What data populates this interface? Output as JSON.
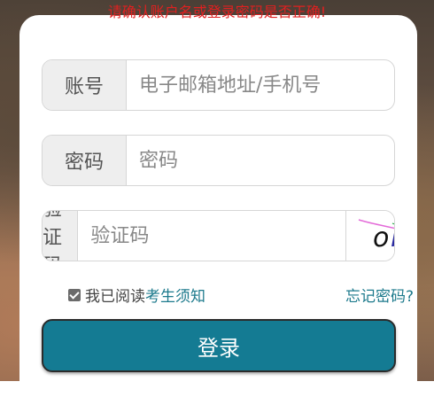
{
  "error_message": "请确认账户名或登录密码是否正确!",
  "account": {
    "label": "账号",
    "placeholder": "电子邮箱地址/手机号",
    "value": ""
  },
  "password": {
    "label": "密码",
    "placeholder": "密码",
    "value": ""
  },
  "captcha": {
    "label": "验证码",
    "placeholder": "验证码",
    "value": "",
    "image_text": "omny"
  },
  "agreement": {
    "checked": true,
    "prefix": "我已阅读",
    "link_text": "考生须知"
  },
  "forgot_password": "忘记密码?",
  "login_button": "登录",
  "colors": {
    "error": "#e02020",
    "accent": "#147b93",
    "link": "#1d7a8c"
  }
}
